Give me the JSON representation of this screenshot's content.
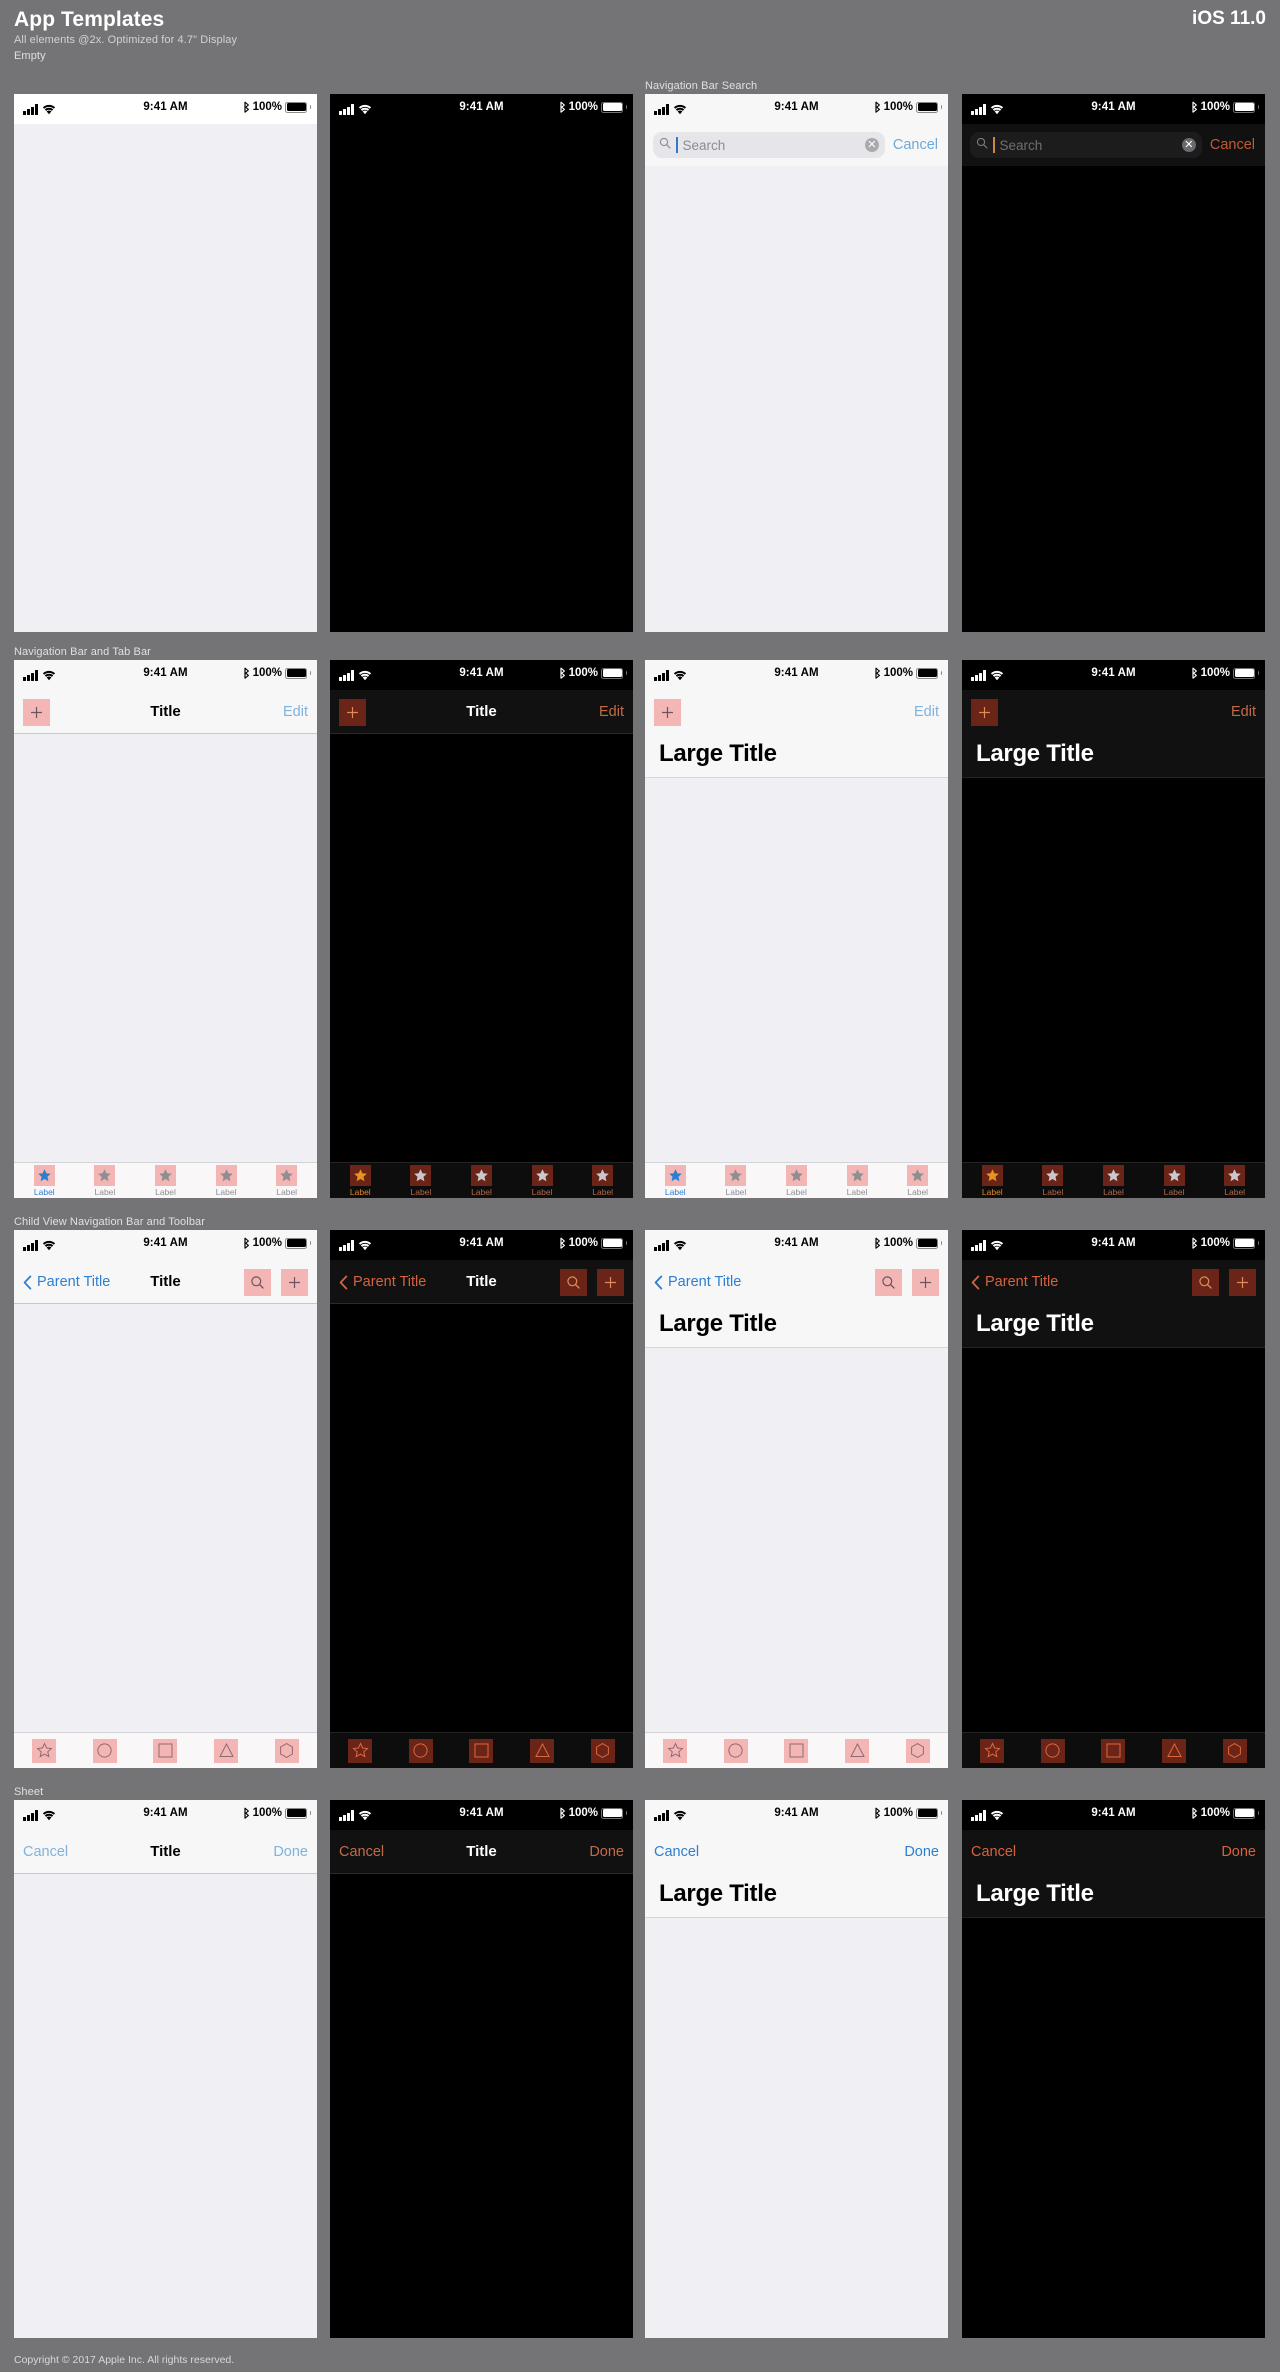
{
  "header": {
    "title": "App Templates",
    "subtitle": "All elements @2x. Optimized for 4.7\" Display",
    "version": "iOS 11.0"
  },
  "footer": {
    "copyright": "Copyright © 2017 Apple Inc. All rights reserved."
  },
  "status_bar": {
    "time": "9:41 AM",
    "battery": "100%",
    "signal_icon": "cellular-bars-icon",
    "wifi_icon": "wifi-icon",
    "bluetooth_icon": "bluetooth-icon",
    "battery_icon": "battery-icon"
  },
  "sections": [
    {
      "label": "Empty"
    },
    {
      "label": "Navigation Bar Search"
    },
    {
      "label": "Navigation Bar and Tab Bar"
    },
    {
      "label": "Child View Navigation Bar and Toolbar"
    },
    {
      "label": "Sheet"
    }
  ],
  "search": {
    "placeholder": "Search",
    "cancel_label": "Cancel",
    "search_icon": "search-icon",
    "clear_icon": "clear-circle-icon",
    "clear_glyph": "✕"
  },
  "navbar": {
    "title": "Title",
    "large_title": "Large Title",
    "edit_label": "Edit",
    "parent_title": "Parent Title",
    "add_icon": "plus-icon",
    "search_icon": "search-icon",
    "back_icon": "chevron-left-icon"
  },
  "sheet": {
    "cancel_label": "Cancel",
    "title": "Title",
    "done_label": "Done"
  },
  "tabbar": {
    "items": [
      {
        "label": "Label",
        "icon": "star-icon",
        "selected": true
      },
      {
        "label": "Label",
        "icon": "star-icon",
        "selected": false
      },
      {
        "label": "Label",
        "icon": "star-icon",
        "selected": false
      },
      {
        "label": "Label",
        "icon": "star-icon",
        "selected": false
      },
      {
        "label": "Label",
        "icon": "star-icon",
        "selected": false
      }
    ]
  },
  "toolbar": {
    "items": [
      {
        "icon": "star-outline-icon"
      },
      {
        "icon": "circle-outline-icon"
      },
      {
        "icon": "square-outline-icon"
      },
      {
        "icon": "triangle-outline-icon"
      },
      {
        "icon": "hexagon-outline-icon"
      }
    ]
  },
  "colors": {
    "canvas": "#747476",
    "light_bg": "#efeff4",
    "light_bar": "#f7f7f8",
    "dark_bg": "#000000",
    "dark_bar": "#111111",
    "light_tint": "#2d7fd0",
    "dark_tint": "#d8623e",
    "placeholder_box_light": "#f4b6b4",
    "placeholder_box_dark": "#6a2418",
    "tab_selected_light": "#2d7fd0",
    "tab_selected_dark": "#e0872c"
  }
}
